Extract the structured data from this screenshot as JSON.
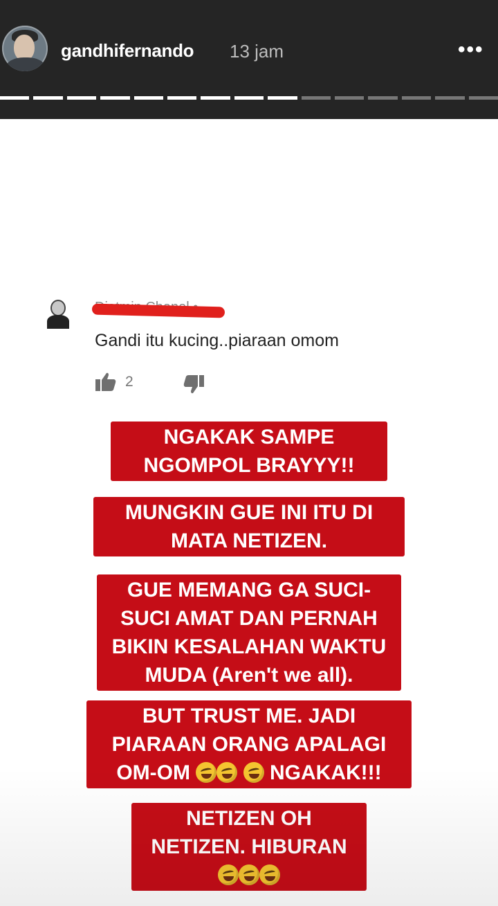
{
  "story_header": {
    "username": "gandhifernando",
    "time": "13 jam",
    "more_glyph": "•••",
    "progress": {
      "segments": 15,
      "completed": 9
    }
  },
  "comment": {
    "author": "Djatmin Chanel •",
    "text": "Gandi itu kucing..piaraan omom",
    "likes": "2",
    "icons": [
      "thumbs-up-icon",
      "thumbs-down-icon"
    ]
  },
  "captions": [
    {
      "text": "NGAKAK SAMPE NGOMPOL BRAYYY!!"
    },
    {
      "text": "MUNGKIN GUE INI ITU DI MATA NETIZEN."
    },
    {
      "text": "GUE MEMANG GA SUCI-SUCI AMAT DAN PERNAH BIKIN KESALAHAN WAKTU MUDA (Aren't we all)."
    },
    {
      "text": "BUT TRUST ME. JADI PIARAAN ORANG APALAGI OM-OM",
      "trail": "NGAKAK!!!"
    },
    {
      "text": "NETIZEN OH NETIZEN. HIBURAN"
    }
  ],
  "colors": {
    "caption_bg": "#c50d17",
    "topbar": "#252525",
    "redaction": "#e0201c"
  }
}
